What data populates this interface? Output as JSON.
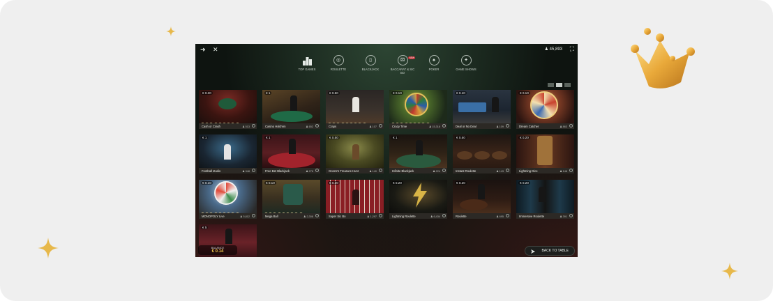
{
  "topbar": {
    "forward_icon": "arrow-right-icon",
    "close_icon": "close-icon",
    "balance_display": "45,893",
    "fullscreen_icon": "collapse-icon"
  },
  "categories": [
    {
      "label": "TOP GAMES",
      "icon": "podium-icon",
      "active": true
    },
    {
      "label": "ROULETTE",
      "icon": "roulette-icon"
    },
    {
      "label": "BLACKJACK",
      "icon": "cards-icon"
    },
    {
      "label": "BACCARAT & SIC BO",
      "icon": "baccarat-icon",
      "badge": "NEW"
    },
    {
      "label": "POKER",
      "icon": "poker-icon"
    },
    {
      "label": "GAME SHOWS",
      "icon": "game-shows-icon"
    }
  ],
  "games": [
    {
      "name": "Cash or Crash",
      "bet": "€ 0.30",
      "players": "513"
    },
    {
      "name": "Casino Hold'em",
      "bet": "€ 1",
      "players": "652"
    },
    {
      "name": "Craps",
      "bet": "€ 0.50",
      "players": "107"
    },
    {
      "name": "Crazy Time",
      "bet": "€ 0.10",
      "players": "15,316"
    },
    {
      "name": "Deal or No Deal",
      "bet": "€ 0.10",
      "players": "109"
    },
    {
      "name": "Dream Catcher",
      "bet": "€ 0.10",
      "players": "863"
    },
    {
      "name": "Football studio",
      "bet": "€ 1",
      "players": "348"
    },
    {
      "name": "Free Bet Blackjack",
      "bet": "€ 1",
      "players": "278"
    },
    {
      "name": "Gonzo's Treasure Hunt",
      "bet": "€ 0.50",
      "players": "140"
    },
    {
      "name": "Infinite Blackjack",
      "bet": "€ 1",
      "players": "224"
    },
    {
      "name": "Instant Roulette",
      "bet": "€ 0.50",
      "players": "143"
    },
    {
      "name": "Lightning Dice",
      "bet": "€ 0.20",
      "players": "148"
    },
    {
      "name": "MONOPOLY Live",
      "bet": "€ 0.10",
      "players": "5,812"
    },
    {
      "name": "Mega Ball",
      "bet": "€ 0.10",
      "players": "2,308"
    },
    {
      "name": "Super Sic Bo",
      "bet": "€ 0.20",
      "players": "1,297"
    },
    {
      "name": "Lightning Roulette",
      "bet": "€ 0.20",
      "players": "6,434"
    },
    {
      "name": "Roulette",
      "bet": "€ 0.20",
      "players": "695"
    },
    {
      "name": "Immersive Roulette",
      "bet": "€ 0.20",
      "players": "391"
    },
    {
      "name": "",
      "bet": "€ 5",
      "players": ""
    }
  ],
  "balance": {
    "label": "BALANCE",
    "value": "€ 0.14"
  },
  "back_button": {
    "label": "BACK TO TABLE",
    "icon": "back-arrow-icon"
  },
  "colors": {
    "accent_gold": "#f2c94c",
    "lobby_bg": "#0e1410",
    "page_bg": "#efefef"
  }
}
